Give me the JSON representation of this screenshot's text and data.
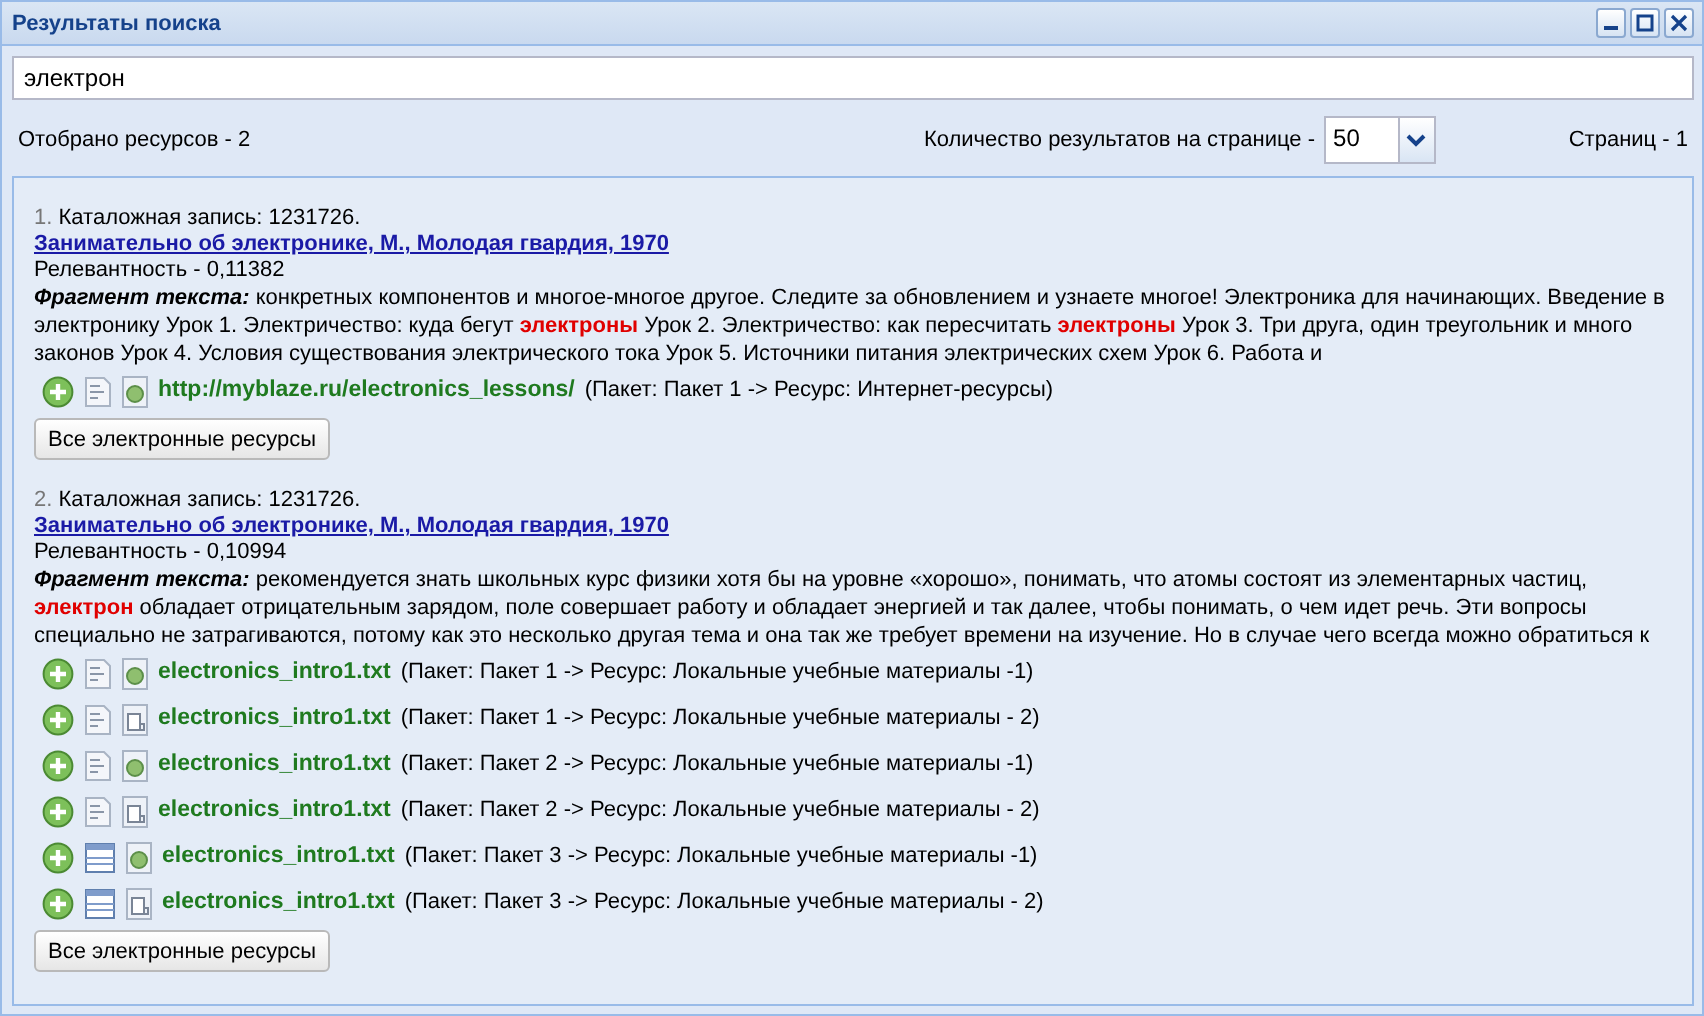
{
  "window": {
    "title": "Результаты поиска"
  },
  "search": {
    "value": "электрон"
  },
  "summary": {
    "found": "Отобрано ресурсов - 2",
    "per_page_label": "Количество результатов на странице -",
    "per_page_value": "50",
    "pages": "Страниц - 1"
  },
  "results": [
    {
      "number": "1.",
      "catalog": "Каталожная запись: 1231726.",
      "title": "Занимательно об электронике, М., Молодая гвардия, 1970",
      "relevance": "Релевантность - 0,11382",
      "fragment_label": "Фрагмент текста:",
      "fragment": "конкретных компонентов и многое-многое другое. Следите за обновлением и узнаете многое! Электроника для начинающих. Введение в электронику Урок 1. Электричество: куда бегут **электроны** Урок 2. Электричество: как пересчитать **электроны** Урок 3. Три друга, один треугольник и много законов Урок 4. Условия существования электрического тока Урок 5. Источники питания электрических схем Урок 6. Работа и",
      "resources": [
        {
          "icons": [
            {
              "kind": "document"
            },
            {
              "kind": "web"
            }
          ],
          "name": "http://myblaze.ru/electronics_lessons/",
          "path": "(Пакет: Пакет 1 -> Ресурс: Интернет-ресурсы)"
        }
      ],
      "button": "Все электронные ресурсы"
    },
    {
      "number": "2.",
      "catalog": "Каталожная запись: 1231726.",
      "title": "Занимательно об электронике, М., Молодая гвардия, 1970",
      "relevance": "Релевантность - 0,10994",
      "fragment_label": "Фрагмент текста:",
      "fragment": "рекомендуется знать школьных курс физики хотя бы на уровне «хорошо», понимать, что атомы состоят из элементарных частиц, **электрон** обладает отрицательным зарядом, поле совершает работу и обладает энергией и так далее, чтобы понимать, о чем идет речь. Эти вопросы специально не затрагиваются, потому как это несколько другая тема и она так же требует времени на изучение. Но в случае чего всегда можно обратиться к",
      "resources": [
        {
          "icons": [
            {
              "kind": "document"
            },
            {
              "kind": "web"
            }
          ],
          "name": "electronics_intro1.txt",
          "path": "(Пакет: Пакет 1 -> Ресурс: Локальные учебные материалы -1)"
        },
        {
          "icons": [
            {
              "kind": "document"
            },
            {
              "kind": "local"
            }
          ],
          "name": "electronics_intro1.txt",
          "path": "(Пакет: Пакет 1 -> Ресурс: Локальные учебные материалы - 2)"
        },
        {
          "icons": [
            {
              "kind": "document"
            },
            {
              "kind": "web"
            }
          ],
          "name": "electronics_intro1.txt",
          "path": "(Пакет: Пакет 2 -> Ресурс: Локальные учебные материалы -1)"
        },
        {
          "icons": [
            {
              "kind": "document"
            },
            {
              "kind": "local"
            }
          ],
          "name": "electronics_intro1.txt",
          "path": "(Пакет: Пакет 2 -> Ресурс: Локальные учебные материалы - 2)"
        },
        {
          "icons": [
            {
              "kind": "table"
            },
            {
              "kind": "web"
            }
          ],
          "name": "electronics_intro1.txt",
          "path": "(Пакет: Пакет 3 -> Ресурс: Локальные учебные материалы -1)"
        },
        {
          "icons": [
            {
              "kind": "table"
            },
            {
              "kind": "local"
            }
          ],
          "name": "electronics_intro1.txt",
          "path": "(Пакет: Пакет 3 -> Ресурс: Локальные учебные материалы - 2)"
        }
      ],
      "button": "Все электронные ресурсы"
    }
  ]
}
